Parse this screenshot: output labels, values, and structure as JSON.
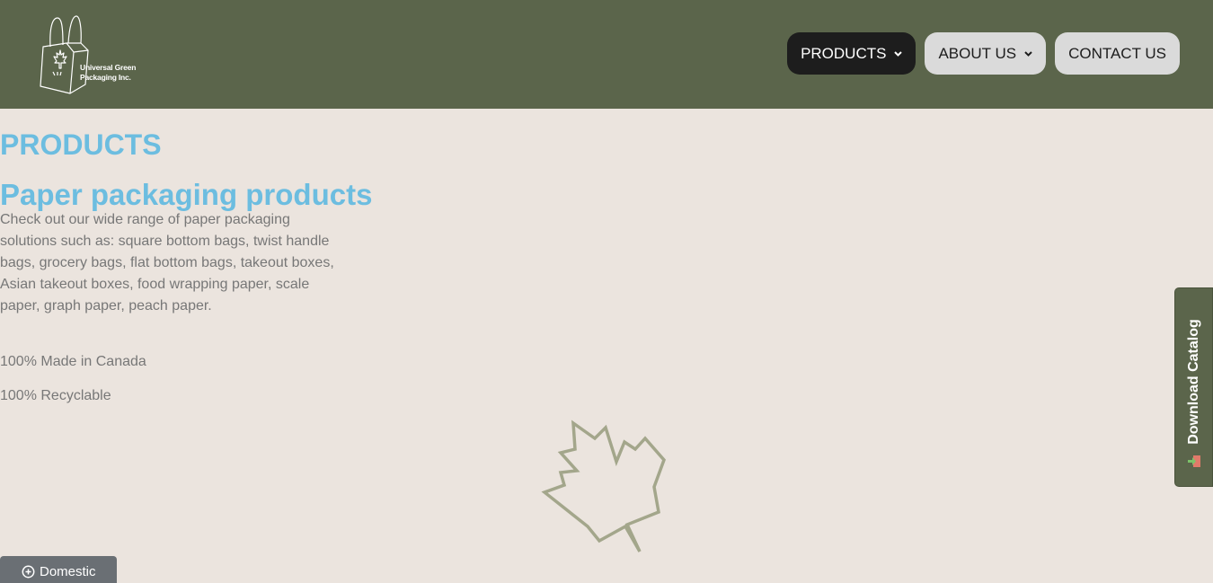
{
  "brand": {
    "line1": "Universal Green",
    "line2": "Packaging Inc."
  },
  "nav": [
    {
      "label": "PRODUCTS",
      "has_dropdown": true,
      "active": true
    },
    {
      "label": "ABOUT US",
      "has_dropdown": true,
      "active": false
    },
    {
      "label": "CONTACT US",
      "has_dropdown": false,
      "active": false
    }
  ],
  "main": {
    "title": "PRODUCTS",
    "subtitle": "Paper packaging products",
    "description": "Check out our wide range of paper packaging solutions such as: square bottom bags, twist handle bags, grocery bags, flat bottom bags, takeout boxes, Asian takeout boxes, food wrapping paper, scale paper, graph paper, peach paper.",
    "facts": [
      "100% Made in Canada",
      "100% Recyclable"
    ]
  },
  "side_tab": {
    "label": "Download Catalog",
    "icon": "download-catalog-icon"
  },
  "region_button": {
    "label": "Domestic",
    "icon": "plus-circle-icon"
  },
  "decor": {
    "icon": "maple-leaf-icon"
  },
  "colors": {
    "header_bg": "#5b654b",
    "page_bg": "#ebe4de",
    "heading": "#6cbde0",
    "body_text": "#777777",
    "nav_active_bg": "#1d1d1d",
    "nav_bg": "#dadada",
    "leaf_stroke": "#a3a68b"
  }
}
